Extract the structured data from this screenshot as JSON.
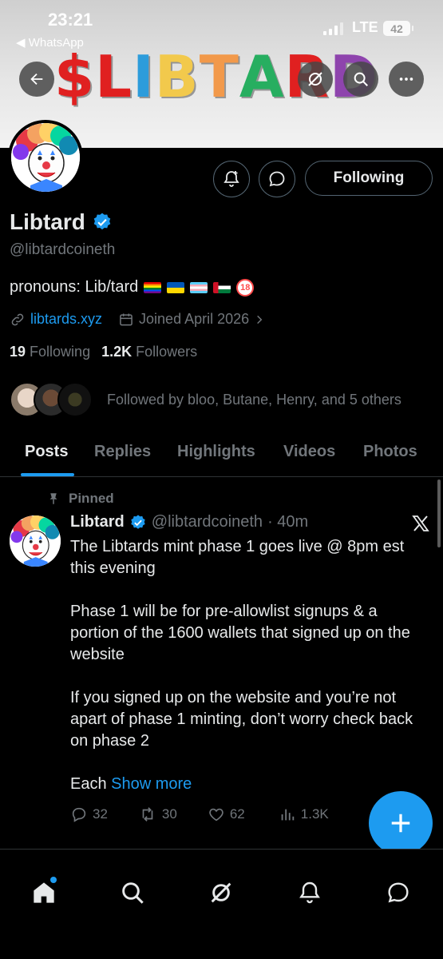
{
  "status_bar": {
    "time": "23:21",
    "back_app": "◀ WhatsApp",
    "network": "LTE",
    "battery": "42"
  },
  "banner": {
    "text": "$LIBTARD",
    "letter_colors": [
      "#e02020",
      "#e02020",
      "#2d9cdb",
      "#f2c94c",
      "#f2994a",
      "#27ae60",
      "#e02020",
      "#8e44ad"
    ]
  },
  "profile": {
    "name": "Libtard",
    "handle": "@libtardcoineth",
    "bio": "pronouns: Lib/tard",
    "link": "libtards.xyz",
    "joined": "Joined April 2026",
    "following_count": "19",
    "following_label": "Following",
    "followers_count": "1.2K",
    "followers_label": "Followers",
    "followed_by": "Followed by bloo, Butane, Henry, and 5 others",
    "follow_button": "Following"
  },
  "tabs": [
    "Posts",
    "Replies",
    "Highlights",
    "Videos",
    "Photos"
  ],
  "post": {
    "pinned_label": "Pinned",
    "author": "Libtard",
    "handle": "@libtardcoineth",
    "time": "· 40m",
    "paragraphs": [
      "The Libtards mint phase 1 goes live @ 8pm est this evening",
      "Phase 1 will be for pre-allowlist signups & a portion of the 1600 wallets that signed up on the website",
      "If you signed up on the website and you’re not apart of phase 1 minting, don’t worry check back on phase 2"
    ],
    "last_prefix": "Each",
    "show_more": "Show more",
    "replies": "32",
    "reposts": "30",
    "likes": "62",
    "views": "1.3K"
  },
  "colors": {
    "accent": "#1d9bf0",
    "muted": "#71767b",
    "text": "#e7e9ea",
    "border": "#2f3336"
  }
}
